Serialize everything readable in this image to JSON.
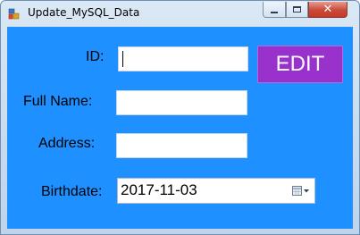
{
  "window": {
    "title": "Update_MySQL_Data"
  },
  "form": {
    "id_label": "ID:",
    "id_value": "",
    "fullname_label": "Full Name:",
    "fullname_value": "",
    "address_label": "Address:",
    "address_value": "",
    "birthdate_label": "Birthdate:",
    "birthdate_value": "2017-11-03",
    "edit_label": "EDIT"
  },
  "colors": {
    "client_background": "#1e90ff",
    "edit_button": "#9932cc"
  },
  "icons": [
    "app-icon",
    "minimize-icon",
    "maximize-icon",
    "close-icon",
    "calendar-dropdown-icon"
  ]
}
